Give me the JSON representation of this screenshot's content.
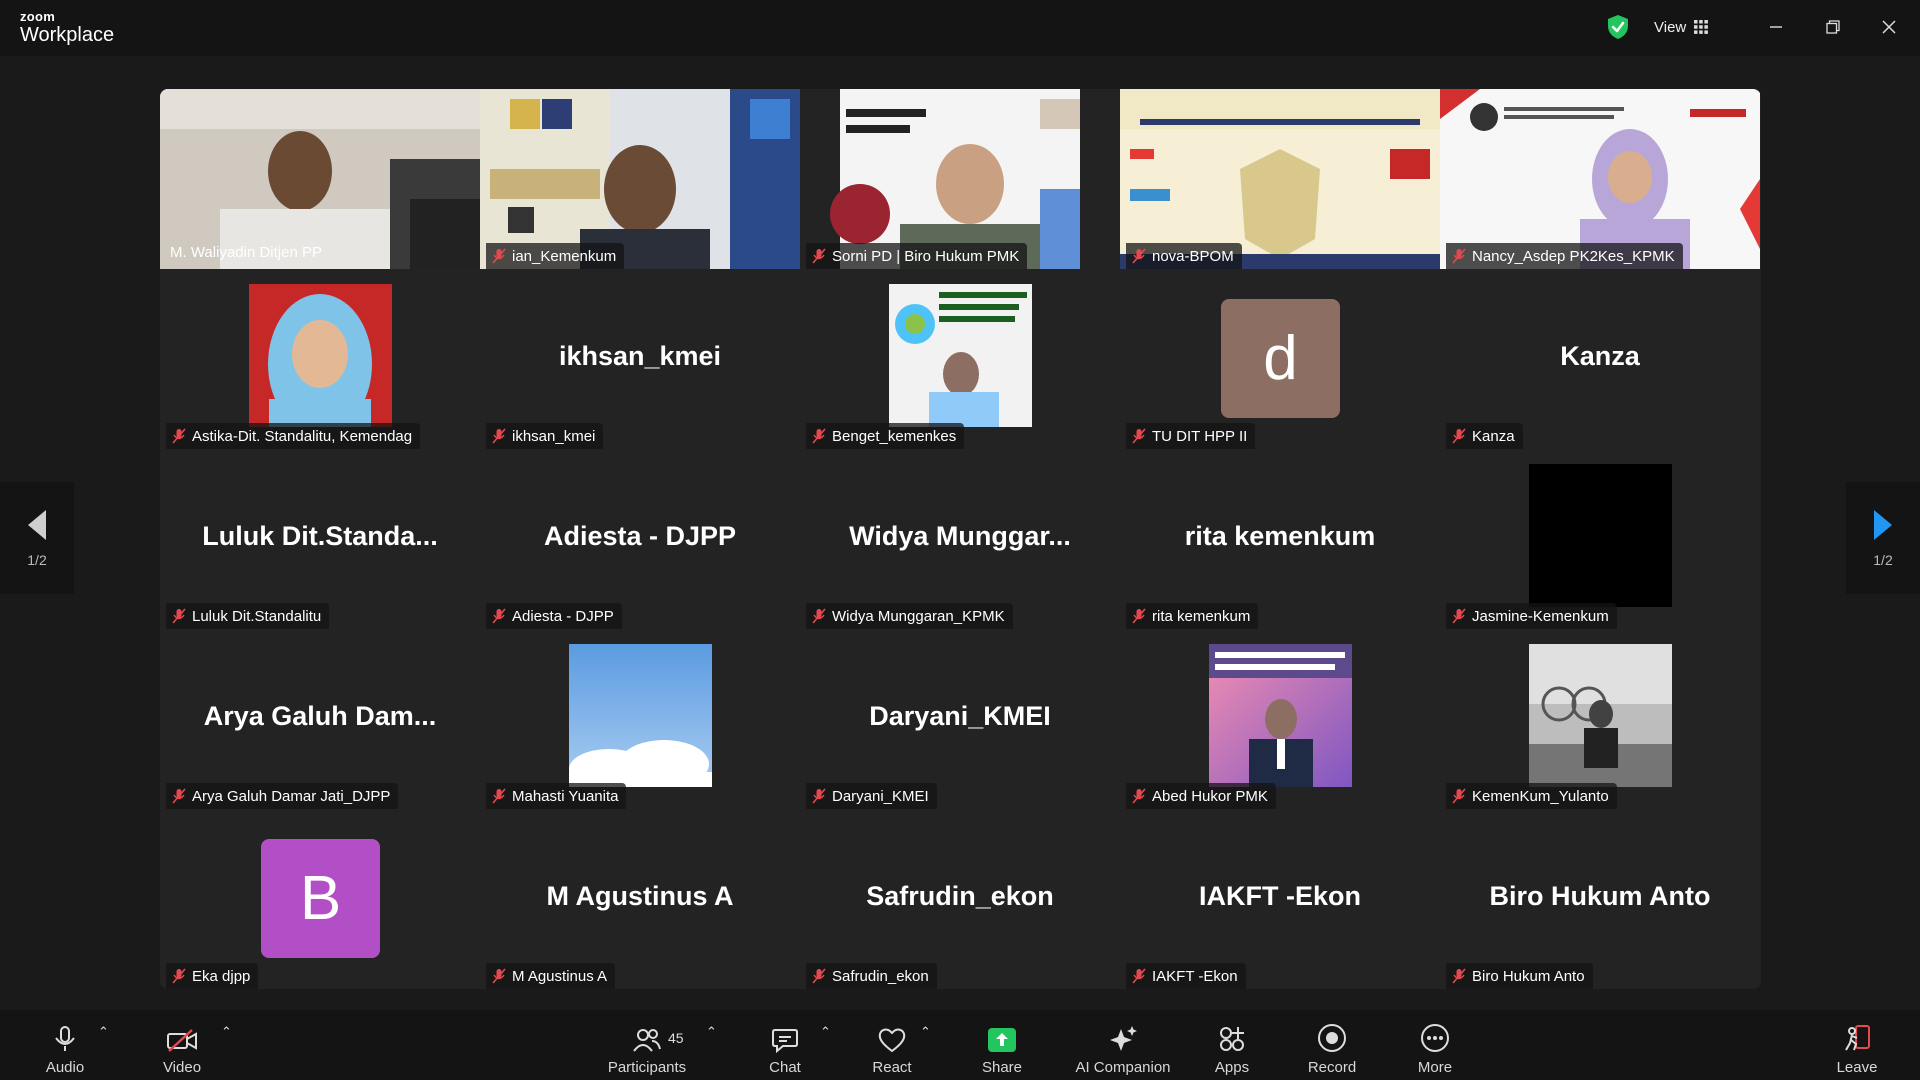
{
  "app": {
    "brand_top": "zoom",
    "brand_bottom": "Workplace"
  },
  "header": {
    "view_label": "View"
  },
  "pagination": {
    "left": "1/2",
    "right": "1/2"
  },
  "tiles": [
    {
      "name": "M. Waliyadin Ditjen PP",
      "active": true
    },
    {
      "name": "ian_Kemenkum"
    },
    {
      "name": "Sorni PD | Biro Hukum PMK"
    },
    {
      "name": "nova-BPOM"
    },
    {
      "name": "Nancy_Asdep PK2Kes_KPMK"
    },
    {
      "name": "Astika-Dit. Standalitu, Kemendag"
    },
    {
      "name": "ikhsan_kmei",
      "display": "ikhsan_kmei"
    },
    {
      "name": "Benget_kemenkes"
    },
    {
      "name": "TU DIT HPP II",
      "avatar_letter": "d",
      "avatar_color": "#8d6e63"
    },
    {
      "name": "Kanza",
      "display": "Kanza"
    },
    {
      "name": "Luluk Dit.Standalitu",
      "display": "Luluk  Dit.Standa..."
    },
    {
      "name": "Adiesta - DJPP",
      "display": "Adiesta - DJPP"
    },
    {
      "name": "Widya Munggaran_KPMK",
      "display": "Widya  Munggar..."
    },
    {
      "name": "rita kemenkum",
      "display": "rita kemenkum"
    },
    {
      "name": "Jasmine-Kemenkum"
    },
    {
      "name": "Arya Galuh Damar Jati_DJPP",
      "display": "Arya Galuh Dam..."
    },
    {
      "name": "Mahasti Yuanita"
    },
    {
      "name": "Daryani_KMEI",
      "display": "Daryani_KMEI"
    },
    {
      "name": "Abed Hukor PMK"
    },
    {
      "name": "KemenKum_Yulanto"
    },
    {
      "name": "Eka djpp",
      "avatar_letter": "B",
      "avatar_color": "#b24fc6"
    },
    {
      "name": "M Agustinus A",
      "display": "M Agustinus A"
    },
    {
      "name": "Safrudin_ekon",
      "display": "Safrudin_ekon"
    },
    {
      "name": "IAKFT -Ekon",
      "display": "IAKFT -Ekon"
    },
    {
      "name": "Biro Hukum Anto",
      "display": "Biro Hukum Anto"
    }
  ],
  "toolbar": {
    "audio": "Audio",
    "video": "Video",
    "participants": "Participants",
    "participants_count": "45",
    "chat": "Chat",
    "react": "React",
    "share": "Share",
    "ai_companion": "AI Companion",
    "apps": "Apps",
    "record": "Record",
    "more": "More",
    "leave": "Leave"
  },
  "colors": {
    "active_speaker": "#2bc66b",
    "share_green": "#22c55e",
    "leave_red": "#e5484d",
    "pager_arrow": "#2196f3"
  }
}
